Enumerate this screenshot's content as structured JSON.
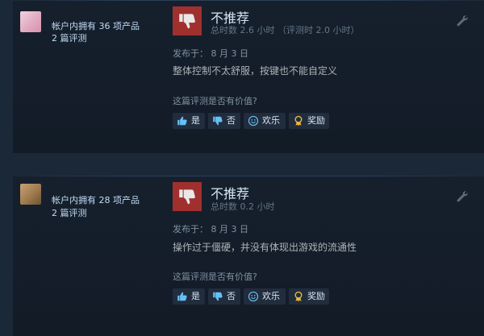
{
  "reviews": [
    {
      "owned": "帐户内拥有 36 项产品",
      "review_count": "2 篇评测",
      "verdict": "不推荐",
      "hours": "总时数 2.6 小时  （评测时 2.0 小时）",
      "posted": "发布于：  8 月 3 日",
      "text": "整体控制不太舒服，按键也不能自定义",
      "helpful_question": "这篇评测是否有价值?",
      "buttons": {
        "yes": "是",
        "no": "否",
        "funny": "欢乐",
        "award": "奖励"
      }
    },
    {
      "owned": "帐户内拥有 28 项产品",
      "review_count": "2 篇评测",
      "verdict": "不推荐",
      "hours": "总时数 0.2 小时",
      "posted": "发布于：  8 月 3 日",
      "text": "操作过于僵硬，并没有体现出游戏的流通性",
      "helpful_question": "这篇评测是否有价值?",
      "buttons": {
        "yes": "是",
        "no": "否",
        "funny": "欢乐",
        "award": "奖励"
      }
    }
  ],
  "icons": {
    "verdict": "thumbs-down-icon",
    "options": "wrench-icon",
    "yes": "thumbs-up-icon",
    "no": "thumbs-down-icon",
    "funny": "smiley-icon",
    "award": "award-icon"
  },
  "colors": {
    "background": "#1b2838",
    "thumb_down_bg": "#a0302e",
    "link": "#66c0f4",
    "text": "#acb2b8"
  }
}
